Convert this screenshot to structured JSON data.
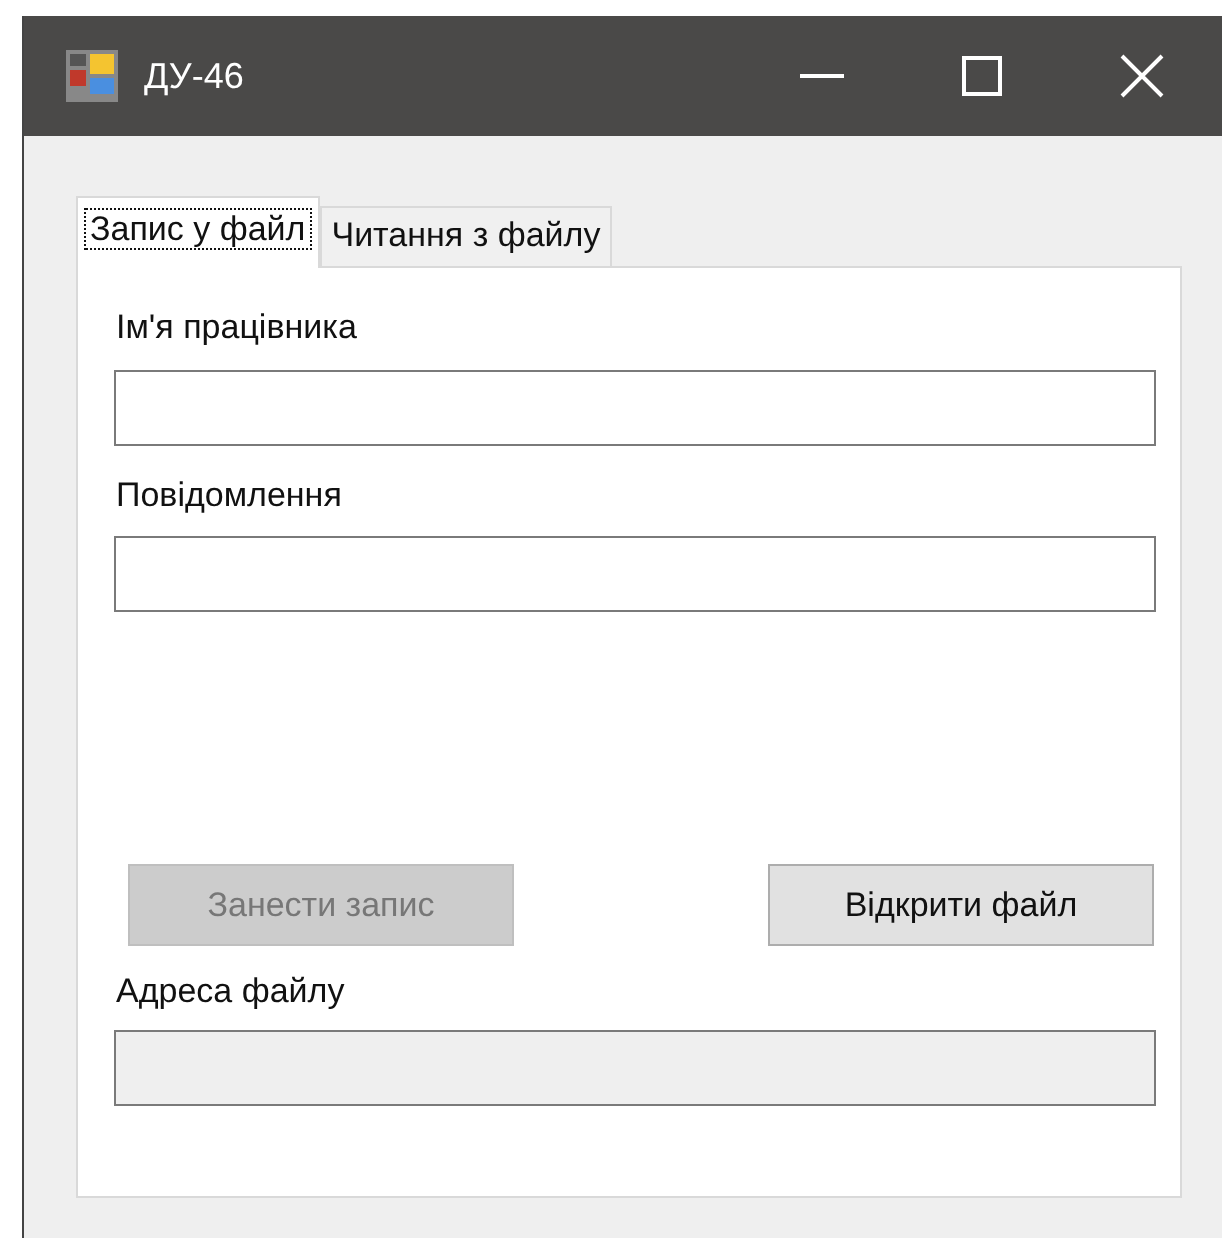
{
  "window": {
    "title": "ДУ-46"
  },
  "tabs": [
    {
      "label": "Запис у файл",
      "selected": true
    },
    {
      "label": "Читання з файлу",
      "selected": false
    }
  ],
  "fields": [
    {
      "label": "Ім'я працівника",
      "disabled": false
    },
    {
      "label": "Повідомлення",
      "disabled": false
    }
  ],
  "buttons": [
    {
      "label": "Занести запис",
      "disabled": true
    },
    {
      "label": "Відкрити файл",
      "disabled": false
    }
  ],
  "file_address": {
    "label": "Адреса файлу",
    "disabled": true
  }
}
